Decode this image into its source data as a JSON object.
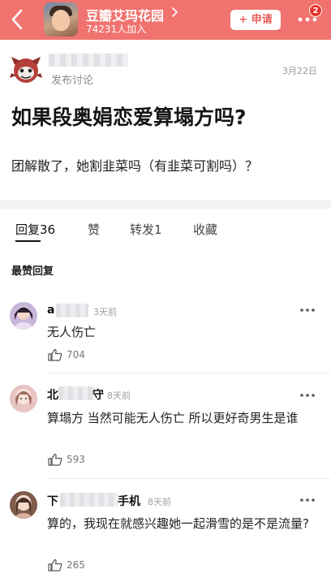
{
  "header": {
    "group_name": "豆瓣艾玛花园",
    "members": "74231人加入",
    "apply_label": "+ 申请",
    "badge_count": "2"
  },
  "post": {
    "action": "发布讨论",
    "date": "3月22日",
    "title": "如果段奥娟恋爱算塌方吗?",
    "body": "团解散了，她割韭菜吗（有韭菜可割吗）？"
  },
  "tabs": [
    {
      "label": "回复",
      "count": "36"
    },
    {
      "label": "赞"
    },
    {
      "label": "转发",
      "count": "1"
    },
    {
      "label": "收藏"
    }
  ],
  "section_title": "最赞回复",
  "comments": [
    {
      "name_visible": "a",
      "time": "3天前",
      "text": "无人伤亡",
      "likes": "704"
    },
    {
      "name_visible": "北",
      "name_suffix": "守",
      "time": "8天前",
      "text": "算塌方 当然可能无人伤亡 所以更好奇男生是谁",
      "likes": "593"
    },
    {
      "name_visible": "下",
      "name_suffix": "手机",
      "time": "8天前",
      "text": "算的，我现在就感兴趣她一起滑雪的是不是流量?",
      "likes": "265"
    }
  ],
  "colors": {
    "header_bg": "#f0736f",
    "accent": "#e9615c",
    "badge": "#e8342c"
  }
}
